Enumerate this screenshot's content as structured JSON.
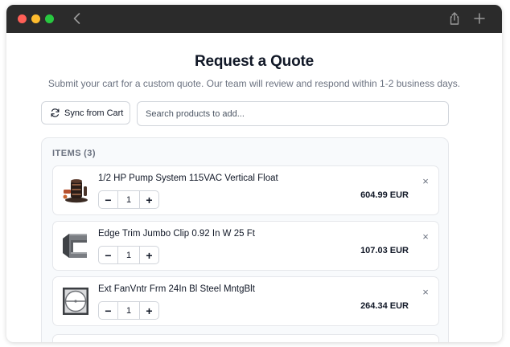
{
  "page": {
    "title": "Request a Quote",
    "subtitle": "Submit your cart for a custom quote. Our team will review and respond within 1-2 business days."
  },
  "toolbar": {
    "sync_label": "Sync from Cart",
    "search_placeholder": "Search products to add..."
  },
  "items_section": {
    "heading": "ITEMS",
    "count": "(3)"
  },
  "items": [
    {
      "name": "1/2 HP Pump System 115VAC Vertical Float",
      "quantity": "1",
      "price": "604.99 EUR",
      "icon": "pump-image"
    },
    {
      "name": "Edge Trim Jumbo Clip 0.92 In W 25 Ft",
      "quantity": "1",
      "price": "107.03 EUR",
      "icon": "edge-trim-image"
    },
    {
      "name": "Ext FanVntr Frm 24In Bl Steel MntgBlt",
      "quantity": "1",
      "price": "264.34 EUR",
      "icon": "fan-frame-image"
    }
  ],
  "controls": {
    "decrement": "−",
    "increment": "+",
    "remove": "×"
  },
  "colors": {
    "titlebar": "#2b2b2b",
    "panel": "#f8fafc",
    "border": "#e5e7eb"
  }
}
